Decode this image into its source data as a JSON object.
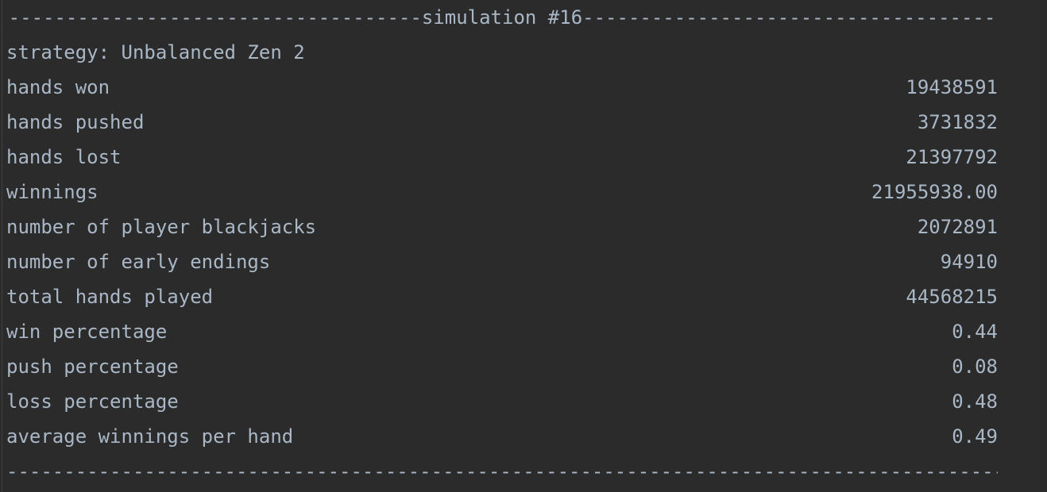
{
  "console": {
    "header_title": "simulation #16",
    "strategy_line": "strategy: Unbalanced Zen 2",
    "rows": [
      {
        "label": "hands won",
        "value": "19438591"
      },
      {
        "label": "hands pushed",
        "value": "3731832"
      },
      {
        "label": "hands lost",
        "value": "21397792"
      },
      {
        "label": "winnings",
        "value": "21955938.00"
      },
      {
        "label": "number of player blackjacks",
        "value": "2072891"
      },
      {
        "label": "number of early endings",
        "value": "94910"
      },
      {
        "label": "total hands played",
        "value": "44568215"
      },
      {
        "label": "win percentage",
        "value": "0.44"
      },
      {
        "label": "push percentage",
        "value": "0.08"
      },
      {
        "label": "loss percentage",
        "value": "0.48"
      },
      {
        "label": "average winnings per hand",
        "value": "0.49"
      }
    ]
  },
  "colors": {
    "background": "#2b2b2b",
    "text": "#a9b7c6",
    "gutter": "#3c3f41"
  }
}
